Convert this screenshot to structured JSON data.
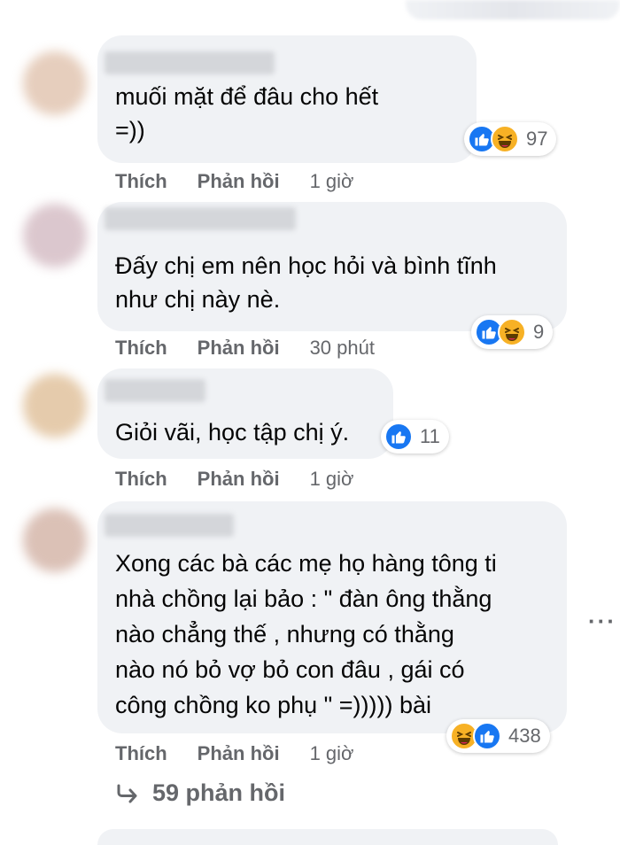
{
  "comments": [
    {
      "text": "muối mặt để đâu cho hết\n=))",
      "reaction_count": "97",
      "like_label": "Thích",
      "reply_label": "Phản hồi",
      "time": "1 giờ"
    },
    {
      "text": "Đấy chị em nên học hỏi và bình tĩnh\nnhư chị này nè.",
      "reaction_count": "9",
      "like_label": "Thích",
      "reply_label": "Phản hồi",
      "time": "30 phút"
    },
    {
      "text": "Giỏi vãi, học tập chị ý.",
      "reaction_count": "11",
      "like_label": "Thích",
      "reply_label": "Phản hồi",
      "time": "1 giờ"
    },
    {
      "text": "Xong các bà các mẹ họ hàng tông ti\nnhà chồng lại bảo : \" đàn ông thằng\nnào chẳng thế , nhưng có thằng\nnào nó bỏ vợ bỏ con đâu , gái có\ncông chồng ko phụ \" =))))) bài",
      "reaction_count": "438",
      "like_label": "Thích",
      "reply_label": "Phản hồi",
      "time": "1 giờ"
    }
  ],
  "view_replies": "59 phản hồi",
  "more_menu": "···",
  "icons": {
    "like": "like-reaction-icon",
    "haha": "haha-reaction-icon",
    "reply_arrow": "reply-arrow-icon",
    "more": "more-options-icon"
  },
  "colors": {
    "bubble": "#f0f2f5",
    "meta_text": "#65676b",
    "like_blue": "#1877f2",
    "haha_yellow": "#f7b125"
  }
}
